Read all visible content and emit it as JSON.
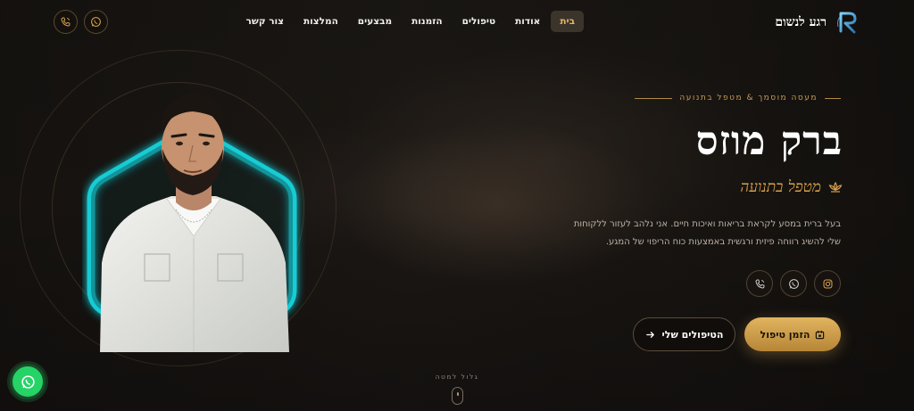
{
  "brand": {
    "name": "רגע לנשום",
    "logo_letter": "R"
  },
  "nav": {
    "items": [
      {
        "label": "בית",
        "active": true
      },
      {
        "label": "אודות",
        "active": false
      },
      {
        "label": "טיפולים",
        "active": false
      },
      {
        "label": "הזמנות",
        "active": false
      },
      {
        "label": "מבצעים",
        "active": false
      },
      {
        "label": "המלצות",
        "active": false
      },
      {
        "label": "צור קשר",
        "active": false
      }
    ],
    "icons": [
      "whatsapp-icon",
      "phone-icon"
    ]
  },
  "hero": {
    "subtitle": "מעסה מוסמך & מטפל בתנועה",
    "name": "ברק מוזס",
    "role": "מטפל בתנועה",
    "bio_line1": "בעל ברית במסע לקראת בריאות ואיכות חיים. אני נלהב לעזור ללקוחות",
    "bio_line2": "שלי להשיג רווחה פיזית ורגשית באמצעות כוח הריפוי של המגע.",
    "social_icons": [
      "instagram-icon",
      "whatsapp-icon",
      "phone-icon"
    ],
    "primary_cta": "הזמן טיפול",
    "secondary_cta": "הטיפולים שלי"
  },
  "scroll_hint": "גלול למטה",
  "colors": {
    "accent_gold": "#d7a04d",
    "portrait_frame": "#19d6e0",
    "whatsapp_green": "#25d366",
    "background": "#151210"
  }
}
